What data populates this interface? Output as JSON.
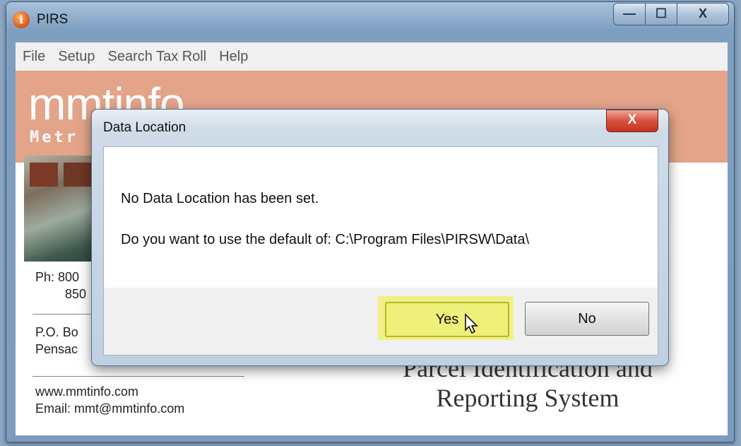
{
  "window": {
    "title": "PIRS",
    "app_icon_glyph": "i"
  },
  "caption": {
    "minimize_glyph": "—",
    "maximize_glyph": "☐",
    "close_glyph": "X"
  },
  "menu": [
    "File",
    "Setup",
    "Search Tax Roll",
    "Help"
  ],
  "banner": {
    "logo": "mmtinfo",
    "logo_sub": "Metr"
  },
  "contact": {
    "phone1": "Ph: 800",
    "phone2": "850",
    "address1": "P.O. Bo",
    "address2": "Pensac",
    "website": "www.mmtinfo.com",
    "email": "Email: mmt@mmtinfo.com"
  },
  "app_name": {
    "line1": "Parcel Identification and",
    "line2": "Reporting System"
  },
  "dialog": {
    "title": "Data Location",
    "close_glyph": "X",
    "message1": "No Data Location has been set.",
    "message2": "Do you want to use the default of: C:\\Program Files\\PIRSW\\Data\\",
    "yes_label": "Yes",
    "no_label": "No"
  },
  "colors": {
    "banner": "#e3a48a",
    "highlight": "#eef07a",
    "close": "#d9513c"
  }
}
